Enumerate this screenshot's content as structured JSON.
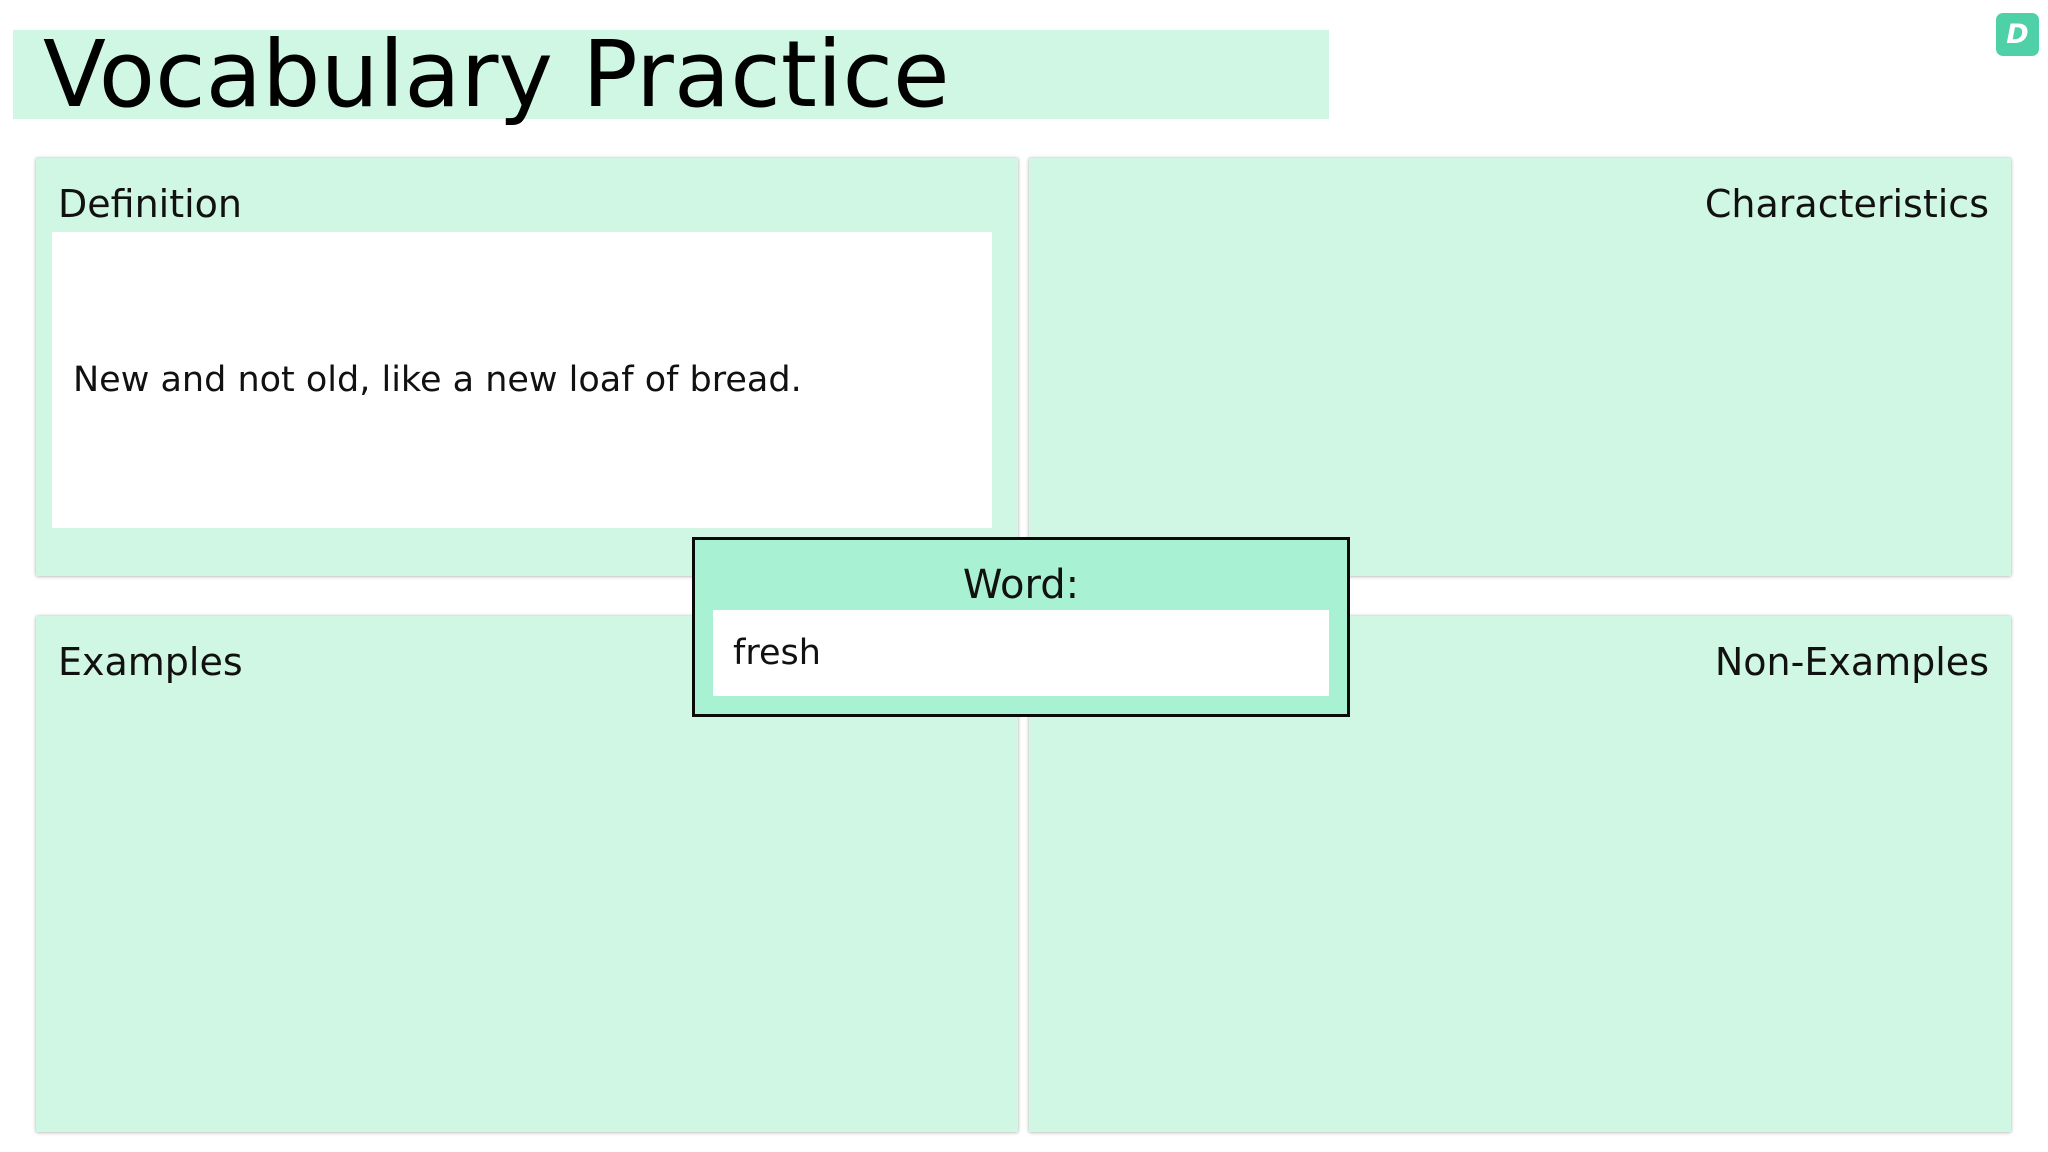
{
  "header": {
    "title": "Vocabulary Practice",
    "logo_letter": "D",
    "logo_color": "#4fd1a8"
  },
  "colors": {
    "panel_background": "#d0f7e4",
    "word_box_background": "#a8f1d2"
  },
  "definition": {
    "label": "Definition",
    "text": "New and not old, like a new loaf of bread."
  },
  "characteristics": {
    "label": "Characteristics"
  },
  "examples": {
    "label": "Examples"
  },
  "non_examples": {
    "label": "Non-Examples"
  },
  "word": {
    "label": "Word:",
    "value": "fresh"
  }
}
